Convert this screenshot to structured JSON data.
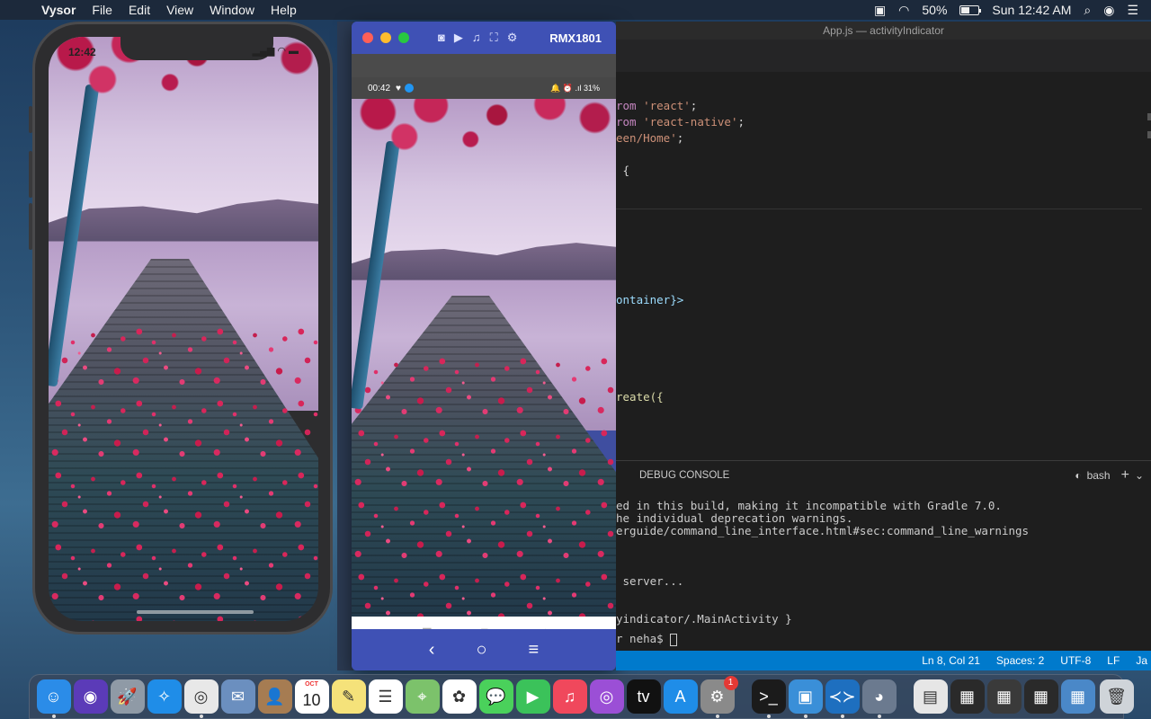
{
  "menubar": {
    "app_name": "Vysor",
    "items": [
      "File",
      "Edit",
      "View",
      "Window",
      "Help"
    ],
    "battery": "50%",
    "clock": "Sun 12:42 AM",
    "battery_level": 0.5
  },
  "ios_sim": {
    "time": "12:42",
    "status_icons": "▂▄▆ ◠ ▬"
  },
  "vysor": {
    "device_name": "RMX1801",
    "android_time": "00:42",
    "android_status_right": "🔔 ⏰ .ıl 31%",
    "nav_back": "‹",
    "nav_home": "○",
    "nav_menu": "≡",
    "app_nav_menu": "☰",
    "app_nav_home": "▢",
    "app_nav_back": "◁"
  },
  "vscode": {
    "window_title": "App.js — activityIndicator",
    "code_lines": [
      {
        "kw": "rom ",
        "str": "'react'",
        "rest": ";"
      },
      {
        "kw": "rom ",
        "str": "'react-native'",
        "rest": ";"
      },
      {
        "kw": "",
        "str": "een/Home'",
        "rest": ";"
      },
      {
        "kw": "",
        "str": "",
        "rest": " {"
      },
      {
        "kw": "",
        "str": "",
        "rest": "ontainer}>"
      },
      {
        "kw": "",
        "str": "",
        "rest": "reate({"
      }
    ],
    "panel_tab": "DEBUG CONSOLE",
    "shell": "bash",
    "terminal_lines": [
      "ed in this build, making it incompatible with Gradle 7.0.",
      "he individual deprecation warnings.",
      "erguide/command_line_interface.html#sec:command_line_warnings",
      " server...",
      "yindicator/.MainActivity }",
      "r neha$ "
    ],
    "status": {
      "position": "Ln 8, Col 21",
      "spaces": "Spaces: 2",
      "encoding": "UTF-8",
      "eol": "LF",
      "language": "Ja"
    }
  },
  "dock": {
    "apps": [
      {
        "name": "Finder",
        "color": "#2b8ce8",
        "glyph": "☺",
        "running": true
      },
      {
        "name": "Siri",
        "color": "#5b3bb8",
        "glyph": "◉",
        "running": false
      },
      {
        "name": "Launchpad",
        "color": "#8f9aa6",
        "glyph": "🚀",
        "running": false
      },
      {
        "name": "Safari",
        "color": "#1f8de8",
        "glyph": "✧",
        "running": false
      },
      {
        "name": "Chrome",
        "color": "#e8e8e8",
        "glyph": "◎",
        "running": true
      },
      {
        "name": "Mail",
        "color": "#6b8fbf",
        "glyph": "✉",
        "running": false
      },
      {
        "name": "Contacts",
        "color": "#a67c52",
        "glyph": "👤",
        "running": false
      },
      {
        "name": "Calendar",
        "color": "#ffffff",
        "glyph": "",
        "running": false
      },
      {
        "name": "Notes",
        "color": "#f5e27a",
        "glyph": "✎",
        "running": false
      },
      {
        "name": "Reminders",
        "color": "#ffffff",
        "glyph": "☰",
        "running": false
      },
      {
        "name": "Maps",
        "color": "#7cc26b",
        "glyph": "⌖",
        "running": false
      },
      {
        "name": "Photos",
        "color": "#ffffff",
        "glyph": "✿",
        "running": false
      },
      {
        "name": "Messages",
        "color": "#4ad15b",
        "glyph": "💬",
        "running": false
      },
      {
        "name": "FaceTime",
        "color": "#3bc25a",
        "glyph": "▶",
        "running": false
      },
      {
        "name": "Music",
        "color": "#f0485c",
        "glyph": "♫",
        "running": false
      },
      {
        "name": "Podcasts",
        "color": "#9b4fd6",
        "glyph": "◎",
        "running": false
      },
      {
        "name": "TV",
        "color": "#111111",
        "glyph": "tv",
        "running": false
      },
      {
        "name": "App Store",
        "color": "#1f8de8",
        "glyph": "A",
        "running": false
      },
      {
        "name": "System Preferences",
        "color": "#8a8a8a",
        "glyph": "⚙",
        "running": true,
        "badge": "1"
      }
    ],
    "calendar": {
      "month": "OCT",
      "day": "10"
    },
    "apps_right": [
      {
        "name": "Terminal",
        "color": "#1b1b1b",
        "glyph": ">_",
        "running": true
      },
      {
        "name": "Simulator",
        "color": "#3a8fd8",
        "glyph": "▣",
        "running": true
      },
      {
        "name": "Visual Studio Code",
        "color": "#1e6fbf",
        "glyph": "≺≻",
        "running": true
      },
      {
        "name": "Vysor",
        "color": "#6b7a8f",
        "glyph": "◕",
        "running": true
      }
    ],
    "recents": [
      {
        "name": "Recent Doc",
        "color": "#e6e6e6",
        "glyph": "▤"
      },
      {
        "name": "Recent Window 1",
        "color": "#2a2a2a",
        "glyph": "▦"
      },
      {
        "name": "Recent Window 2",
        "color": "#3a3a3a",
        "glyph": "▦"
      },
      {
        "name": "Recent Window 3",
        "color": "#2a2a2a",
        "glyph": "▦"
      },
      {
        "name": "Recent Window 4",
        "color": "#4a88c8",
        "glyph": "▦"
      }
    ],
    "trash": {
      "name": "Trash",
      "color": "#cfd4d9",
      "glyph": "🗑"
    }
  }
}
